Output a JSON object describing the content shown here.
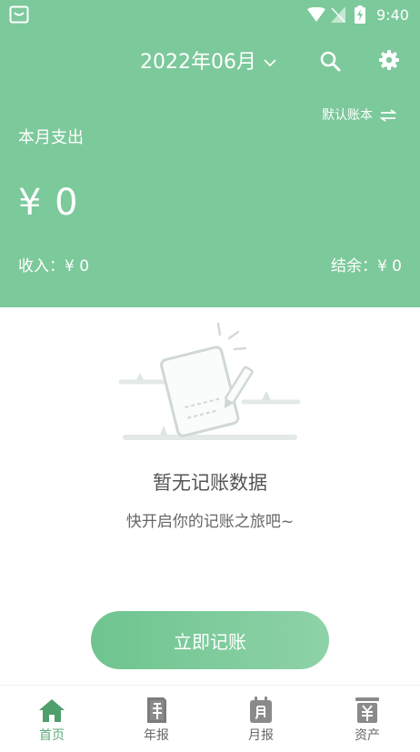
{
  "status_bar": {
    "time": "9:40"
  },
  "header": {
    "month": "2022年06月",
    "account_name": "默认账本",
    "expense_title": "本月支出",
    "expense_amount": "¥ 0",
    "income": "收入：¥ 0",
    "balance": "结余：¥ 0"
  },
  "empty_state": {
    "title": "暂无记账数据",
    "subtitle": "快开启你的记账之旅吧~"
  },
  "record_button": {
    "label": "立即记账"
  },
  "tabs": [
    {
      "label": "首页",
      "icon": "home-icon",
      "active": true
    },
    {
      "label": "年报",
      "icon": "year-report-icon",
      "active": false
    },
    {
      "label": "月报",
      "icon": "month-report-icon",
      "active": false
    },
    {
      "label": "资产",
      "icon": "assets-icon",
      "active": false
    }
  ],
  "colors": {
    "primary_green": "#7cc99b",
    "active_tab": "#5aab78"
  }
}
